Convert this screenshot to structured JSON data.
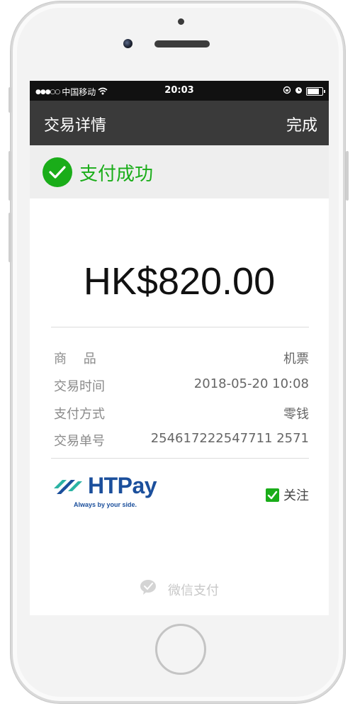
{
  "status_bar": {
    "signal_dots": "●●●○○",
    "carrier": "中国移动",
    "time": "20:03"
  },
  "nav": {
    "title": "交易详情",
    "done_label": "完成"
  },
  "payment": {
    "status_text": "支付成功",
    "amount": "HK$820.00"
  },
  "details": [
    {
      "label": "商　 品",
      "value": "机票"
    },
    {
      "label": "交易时间",
      "value": "2018-05-20 10:08"
    },
    {
      "label": "支付方式",
      "value": "零钱"
    },
    {
      "label": "交易单号",
      "value": "254617222547711 2571"
    }
  ],
  "merchant": {
    "logo_text": "HTPay",
    "tagline": "Always by your side.",
    "follow_label": "关注",
    "follow_checked": true
  },
  "footer": {
    "brand": "微信支付"
  },
  "colors": {
    "accent_green": "#1aad19",
    "navbar_bg": "#3a3a3a",
    "logo_blue": "#1b4f9c"
  },
  "icons": {
    "success": "check-circle-icon",
    "wifi": "wifi-icon",
    "battery": "battery-icon",
    "alarm": "alarm-icon",
    "follow": "checkbox-icon",
    "wechat": "wechat-pay-icon"
  }
}
